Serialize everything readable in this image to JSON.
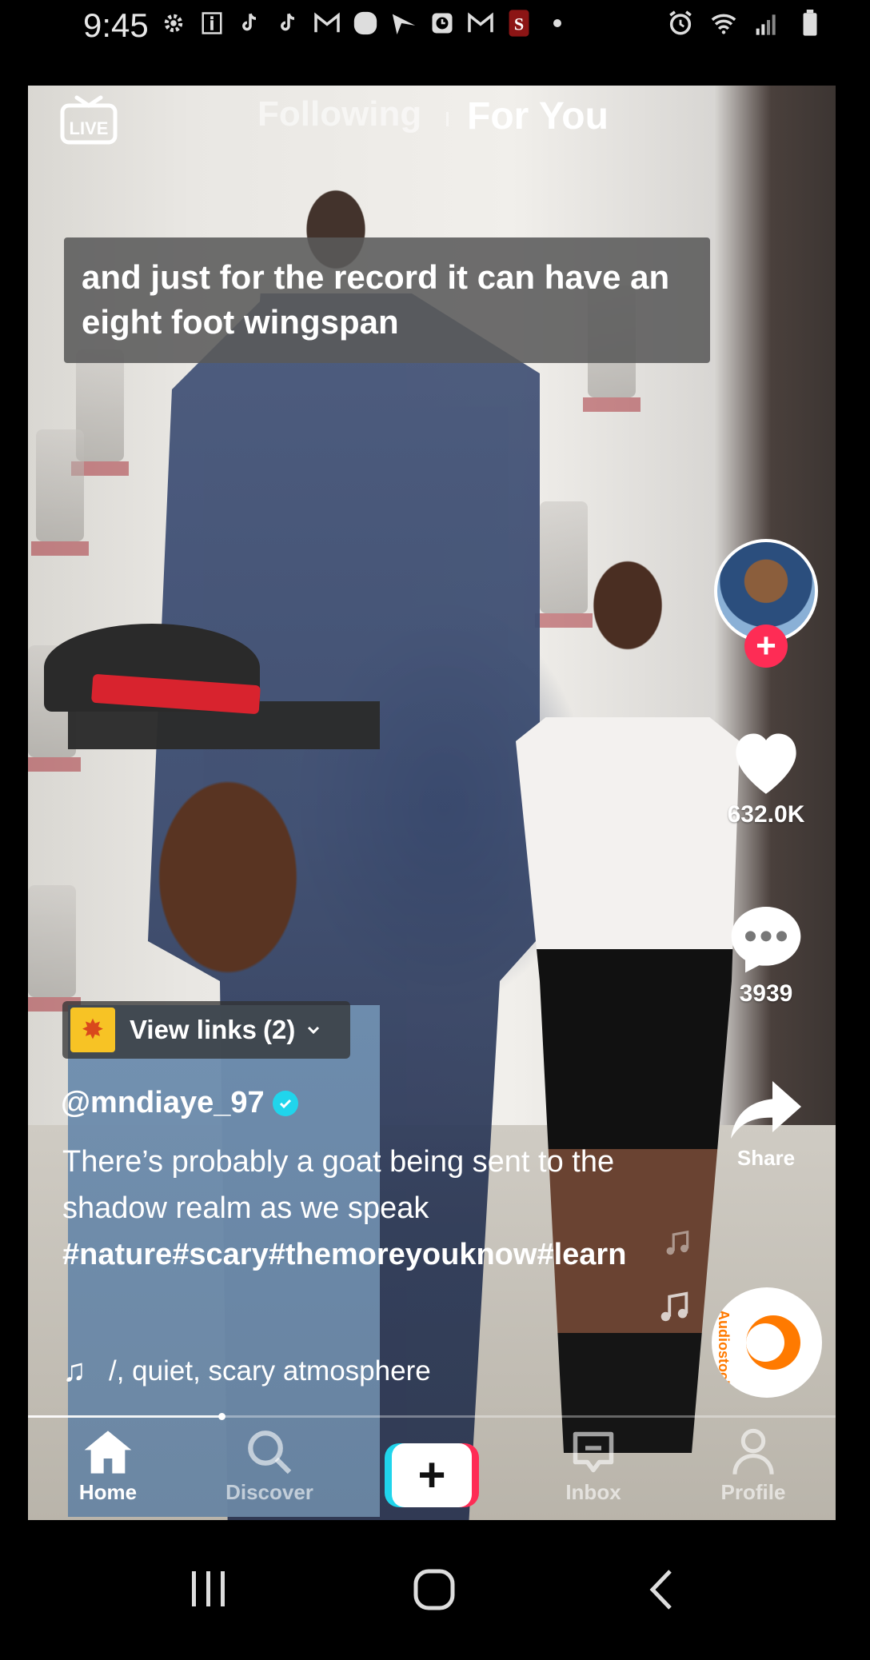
{
  "status_bar": {
    "time": "9:45"
  },
  "top_nav": {
    "live_label": "LIVE",
    "following_label": "Following",
    "foryou_label": "For You"
  },
  "caption": {
    "text": "and just for the record it can have an eight foot wingspan"
  },
  "right_rail": {
    "like_count": "632.0K",
    "comment_count": "3939",
    "share_label": "Share",
    "disc_label": "Audiostock"
  },
  "post": {
    "links_label": "View links",
    "links_count": "(2)",
    "username": "@mndiaye_97",
    "description": "There’s probably a goat being sent to the shadow realm as we speak",
    "hashtags": "#nature#scary#themoreyouknow#learn",
    "sound_name": "/, quiet, scary atmosphere",
    "progress_fraction": 0.24
  },
  "tab_bar": {
    "home_label": "Home",
    "discover_label": "Discover",
    "create_label": "+",
    "inbox_label": "Inbox",
    "profile_label": "Profile"
  },
  "colors": {
    "accent_red": "#fe2c55",
    "accent_cyan": "#20d5ec"
  }
}
